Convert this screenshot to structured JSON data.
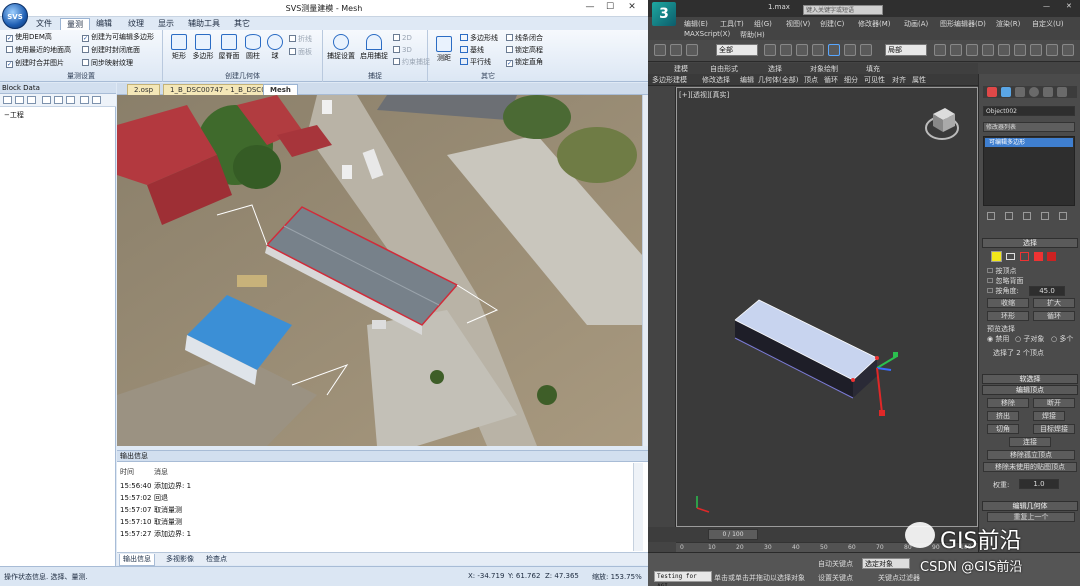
{
  "left_app": {
    "window_title": "SVS测量建模 - Mesh",
    "logo_text": "SVS",
    "menu": [
      "文件",
      "量测",
      "编辑",
      "纹理",
      "显示",
      "辅助工具",
      "其它"
    ],
    "active_menu": "量测",
    "ribbon": {
      "group1": {
        "label": "量测设置",
        "checks": [
          {
            "label": "使用DEM高",
            "checked": true
          },
          {
            "label": "使用最近的地面高",
            "checked": false
          },
          {
            "label": "创建时合并图片",
            "checked": true
          },
          {
            "label": "创建为可编辑多边形",
            "checked": true
          },
          {
            "label": "创建时封闭底面",
            "checked": false
          },
          {
            "label": "同步映射纹理",
            "checked": false
          }
        ]
      },
      "group2": {
        "label": "创建几何体",
        "buttons": [
          "矩形",
          "多边形",
          "屋脊面",
          "圆柱",
          "球"
        ],
        "disabled_checks": [
          "折线",
          "面板"
        ]
      },
      "group3": {
        "label": "捕捉",
        "buttons": [
          "捕捉设置",
          "启用捕捉"
        ],
        "disabled_checks": [
          "2D",
          "3D",
          "约束捕捉"
        ]
      },
      "group4": {
        "label": "其它",
        "buttons": [
          "测距"
        ],
        "small_buttons": [
          "多边形线",
          "基线",
          "平行线"
        ],
        "checks": [
          {
            "label": "线条闭合",
            "checked": false
          },
          {
            "label": "锁定高程",
            "checked": false
          },
          {
            "label": "锁定直角",
            "checked": true
          }
        ]
      }
    },
    "block_panel": {
      "title": "Block Data",
      "tree_root": "工程"
    },
    "doc_tabs": [
      "2.osp",
      "1_B_DSC00747 - 1_B_DSC00705",
      "Mesh"
    ],
    "active_doc_tab": "Mesh",
    "output": {
      "title": "输出信息",
      "headers": [
        "时间",
        "消息"
      ],
      "rows": [
        {
          "time": "15:56:40",
          "msg": "添加边界: 1"
        },
        {
          "time": "15:57:02",
          "msg": "回退"
        },
        {
          "time": "15:57:07",
          "msg": "取消量测"
        },
        {
          "time": "15:57:10",
          "msg": "取消量测"
        },
        {
          "time": "15:57:27",
          "msg": "添加边界: 1"
        }
      ],
      "tabs": [
        "输出信息",
        "多视影像",
        "检查点"
      ]
    },
    "status": {
      "message": "操作状态信息. 选择、量测.",
      "x": "X: -34.719",
      "y": "Y: 61.762",
      "z": "Z: 47.365",
      "zoom": "缩放: 153.75%"
    }
  },
  "right_app": {
    "file_title": "1.max",
    "search_placeholder": "键入关键字或短语",
    "menu_row1": [
      "编辑(E)",
      "工具(T)",
      "组(G)",
      "视图(V)",
      "创建(C)",
      "修改器(M)",
      "动画(A)",
      "图形编辑器(D)",
      "渲染(R)",
      "自定义(U)"
    ],
    "menu_row2": [
      "MAXScript(X)",
      "帮助(H)"
    ],
    "selection_filter": "全部",
    "coord_system": "局部",
    "ribbon_tabs": [
      "建模",
      "自由形式",
      "选择",
      "对象绘制",
      "填充"
    ],
    "ribbon_sub": [
      "多边形建模",
      "修改选择",
      "编辑",
      "几何体(全部)",
      "顶点",
      "循环",
      "细分",
      "可见性",
      "对齐",
      "属性"
    ],
    "viewport_label": "[+][透视][真实]",
    "object_name": "Object002",
    "modifier_list": "修改器列表",
    "stack_item": "可编辑多边形",
    "panel": {
      "rollout_select": "选择",
      "by_vertex": "按顶点",
      "ignore_back": "忽略背面",
      "by_angle": "按角度:",
      "angle_value": "45.0",
      "shrink": "收缩",
      "grow": "扩大",
      "ring": "环形",
      "loop": "循环",
      "preview": "预览选择",
      "preview_opts": [
        "禁用",
        "子对象",
        "多个"
      ],
      "selected_info": "选择了 2 个顶点",
      "soft_sel": "软选择",
      "edit_vertex": "编辑顶点",
      "remove": "移除",
      "break": "断开",
      "extrude": "挤出",
      "weld": "焊接",
      "chamfer": "切角",
      "target_weld": "目标焊接",
      "connect": "连接",
      "remove_isolated": "移除孤立顶点",
      "remove_unused": "移除未使用的贴图顶点",
      "weight_label": "权重:",
      "weight_value": "1.0",
      "edit_geom": "编辑几何体",
      "repeat_last": "重复上一个"
    },
    "time_label": "0 / 100",
    "timeline_ticks": [
      "0",
      "10",
      "20",
      "30",
      "40",
      "50",
      "60",
      "70",
      "80",
      "90",
      "100"
    ],
    "status_text": "单击或单击并拖动以选择对象",
    "script_label": "Testing for AGI",
    "auto_key": "自动关键点",
    "set_key": "设置关键点",
    "selected_obj": "选定对象",
    "key_filter": "关键点过滤器"
  },
  "watermark": {
    "text": "GIS前沿",
    "sub": "CSDN @GIS前沿"
  }
}
